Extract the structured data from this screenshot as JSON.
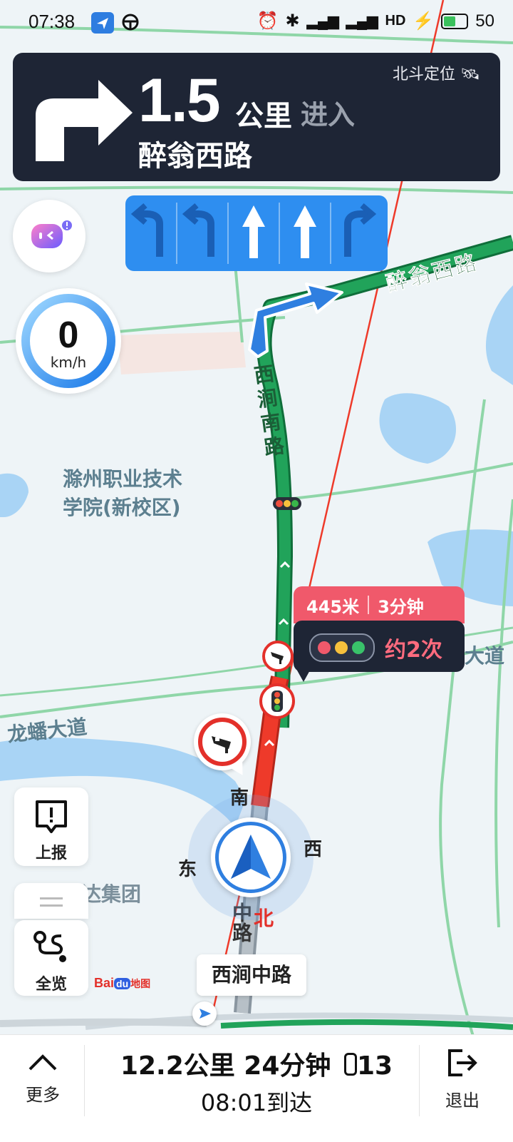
{
  "status": {
    "time": "07:38",
    "battery": "50",
    "net": "HD"
  },
  "banner": {
    "distance": "1.5",
    "unit": "公里",
    "action": "进入",
    "road": "醉翁西路",
    "beidou": "北斗定位"
  },
  "speed": {
    "value": "0",
    "unit": "km/h"
  },
  "map_labels": {
    "campus": "滁州职业技术\n学院(新校区)",
    "campus_line1": "滁州职业技术",
    "campus_line2": "学院(新校区)",
    "road_zuiweng": "醉翁西路",
    "road_xijian_south": "西涧南路",
    "road_longpan": "龙蟠大道",
    "road_dadao_right": "大道",
    "company": "富达集团",
    "road_xijian_mid_fragment": "中路"
  },
  "tooltip": {
    "distance": "445米",
    "time": "3分钟",
    "lights": "约2次"
  },
  "compass": {
    "south": "南",
    "east": "东",
    "west": "西",
    "north": "北"
  },
  "current_road": "西涧中路",
  "buttons": {
    "report": "上报",
    "overview": "全览",
    "more": "更多",
    "exit": "退出"
  },
  "trip": {
    "summary": "12.2公里 24分钟",
    "lights_count": "13",
    "arrival": "08:01到达"
  },
  "logo": {
    "text": "Bai",
    "mid": "du",
    "suffix": "地图"
  },
  "colors": {
    "route_green": "#21a35a",
    "congestion_red": "#ee3a2a",
    "lane_blue": "#2e8ef0",
    "banner_bg": "#1e2535",
    "tooltip_red": "#f0596b"
  }
}
